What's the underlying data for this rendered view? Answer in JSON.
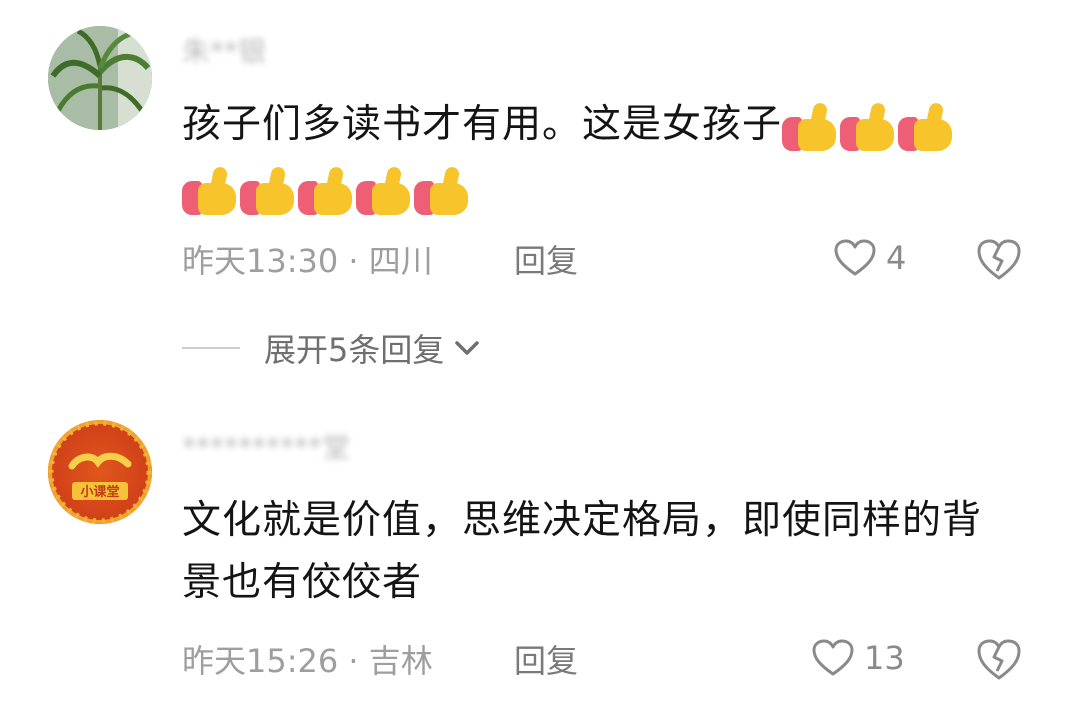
{
  "comments": [
    {
      "username": "朱**银",
      "text": "孩子们多读书才有用。这是女孩子",
      "emoji": [
        "thumbs-up",
        "thumbs-up",
        "thumbs-up",
        "thumbs-up",
        "thumbs-up",
        "thumbs-up",
        "thumbs-up",
        "thumbs-up"
      ],
      "meta": "昨天13:30 · 四川",
      "reply_label": "回复",
      "likes": "4"
    },
    {
      "username": "**********堂",
      "text": "文化就是价值，思维决定格局，即使同样的背景也有佼佼者",
      "meta": "昨天15:26 · 吉林",
      "reply_label": "回复",
      "likes": "13"
    }
  ],
  "expand_replies": {
    "label": "展开5条回复",
    "icon": "chevron-down-icon"
  },
  "avatar_badge_text": "小课堂",
  "colors": {
    "text": "#141414",
    "meta": "#9e9e9e",
    "thumb_yellow": "#f7c42c",
    "thumb_pink": "#ee5f75",
    "badge_orange": "#d4441a"
  }
}
